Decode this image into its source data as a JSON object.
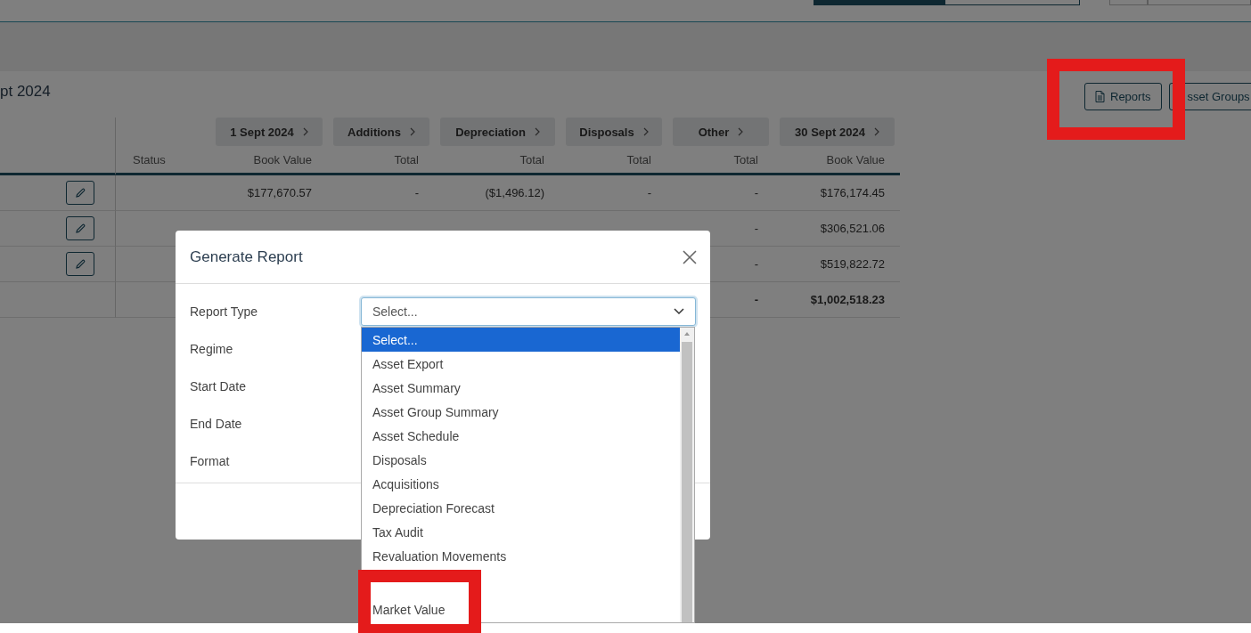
{
  "header": {
    "segments": [
      {
        "selected": true
      },
      {
        "selected": false
      }
    ],
    "buttons": [
      {
        "selected": false
      },
      {
        "selected": false
      }
    ]
  },
  "page_title": "pt 2024",
  "toolbar": [
    {
      "label": "Reports",
      "kind": "document"
    },
    {
      "label": "sset Groups",
      "kind": "plain"
    }
  ],
  "table": {
    "period_headers": [
      "1 Sept 2024",
      "Additions",
      "Depreciation",
      "Disposals",
      "Other",
      "30 Sept 2024"
    ],
    "columns": [
      "Status",
      "Book Value",
      "Total",
      "Total",
      "Total",
      "Total",
      "Book Value"
    ],
    "rows": [
      {
        "editable": true,
        "bold": false,
        "cells": [
          "",
          "$177,670.57",
          "-",
          "($1,496.12)",
          "-",
          "-",
          "$176,174.45"
        ]
      },
      {
        "editable": true,
        "bold": false,
        "cells": [
          "",
          "",
          "",
          "",
          "",
          "-",
          "$306,521.06"
        ]
      },
      {
        "editable": true,
        "bold": false,
        "cells": [
          "",
          "",
          "",
          "",
          "",
          "-",
          "$519,822.72"
        ]
      },
      {
        "editable": false,
        "bold": true,
        "cells": [
          "",
          "",
          "",
          "",
          "",
          "-",
          "$1,002,518.23"
        ]
      }
    ]
  },
  "dialog": {
    "title": "Generate Report",
    "fields": [
      {
        "label": "Report Type",
        "value": "Select..."
      },
      {
        "label": "Regime"
      },
      {
        "label": "Start Date"
      },
      {
        "label": "End Date"
      },
      {
        "label": "Format"
      }
    ],
    "dropdown": {
      "options": [
        {
          "label": "Select...",
          "selected": true
        },
        {
          "label": "Asset Export",
          "selected": false
        },
        {
          "label": "Asset Summary",
          "selected": false
        },
        {
          "label": "Asset Group Summary",
          "selected": false
        },
        {
          "label": "Asset Schedule",
          "selected": false
        },
        {
          "label": "Disposals",
          "selected": false
        },
        {
          "label": "Acquisitions",
          "selected": false
        },
        {
          "label": "Depreciation Forecast",
          "selected": false
        },
        {
          "label": "Tax Audit",
          "selected": false
        },
        {
          "label": "Revaluation Movements",
          "selected": false
        }
      ]
    }
  },
  "annotations": [
    {
      "kind": "frame"
    },
    {
      "kind": "callout",
      "text": "Market Value"
    }
  ]
}
